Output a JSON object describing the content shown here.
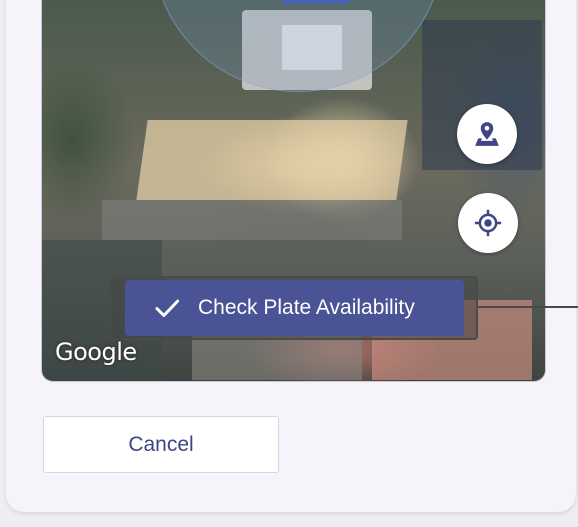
{
  "map": {
    "attribution": "Google",
    "check_button_label": "Check Plate Availability",
    "controls": {
      "pin_icon": "map-pin-icon",
      "locate_icon": "my-location-icon"
    }
  },
  "actions": {
    "cancel_label": "Cancel"
  },
  "colors": {
    "primary": "#4a5395",
    "cancel_text": "#3f4684",
    "card_bg": "#f6f3fb"
  }
}
